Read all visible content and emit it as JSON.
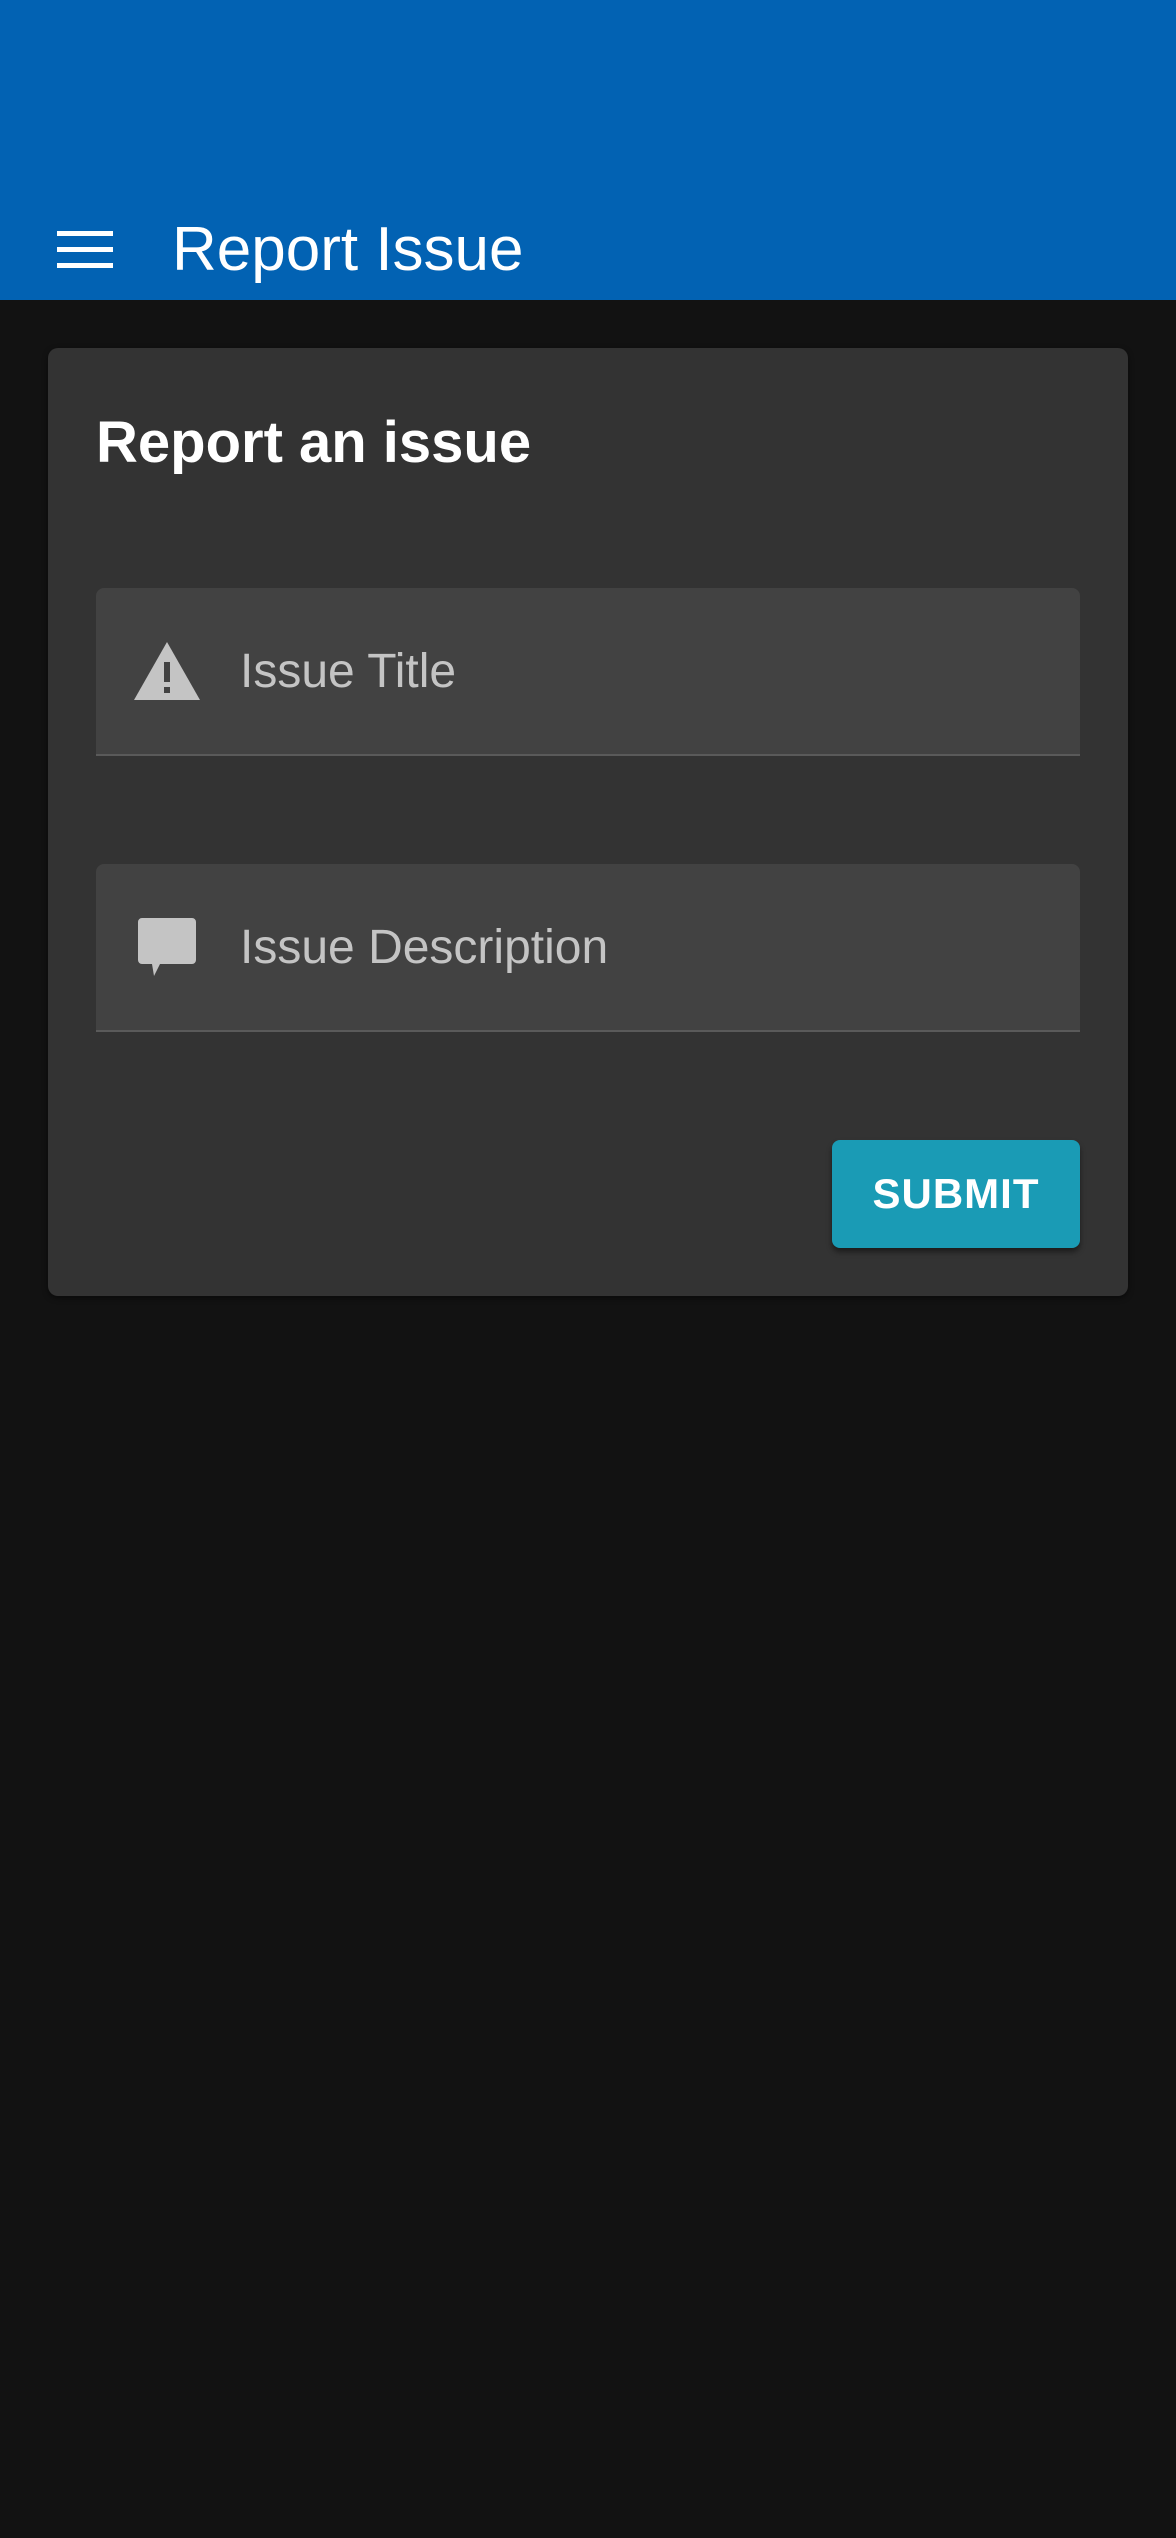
{
  "app_bar": {
    "title": "Report Issue",
    "menu_icon": "hamburger-menu-icon",
    "background_color": "#0262b3"
  },
  "card": {
    "title": "Report an issue",
    "fields": {
      "issue_title": {
        "placeholder": "Issue Title",
        "value": "",
        "icon": "warning-icon"
      },
      "issue_description": {
        "placeholder": "Issue Description",
        "value": "",
        "icon": "comment-icon"
      }
    },
    "submit_label": "SUBMIT",
    "submit_color": "#1a9bb5"
  },
  "theme": {
    "page_background": "#121212",
    "card_background": "#333333",
    "field_background": "#424242"
  }
}
